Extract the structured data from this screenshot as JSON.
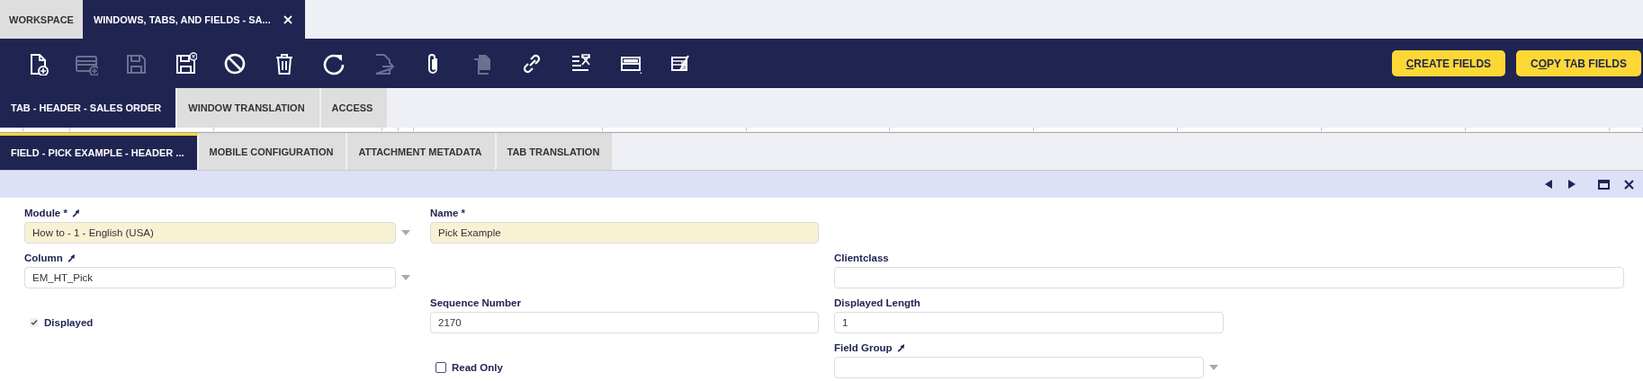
{
  "window_tabs": [
    {
      "label": "WORKSPACE",
      "selected": false,
      "closable": false
    },
    {
      "label": "WINDOWS, TABS, AND FIELDS - SA...",
      "selected": true,
      "closable": true
    }
  ],
  "toolbar": {
    "buttons": [
      {
        "disabled": false
      },
      {
        "disabled": true
      },
      {
        "disabled": true
      },
      {
        "disabled": false
      },
      {
        "disabled": false
      },
      {
        "disabled": false
      },
      {
        "disabled": false
      },
      {
        "disabled": true
      },
      {
        "disabled": false
      },
      {
        "disabled": true
      },
      {
        "disabled": false
      },
      {
        "disabled": false
      },
      {
        "disabled": false
      },
      {
        "disabled": false
      }
    ],
    "actions": [
      {
        "key": "C",
        "after": "REATE FIELDS"
      },
      {
        "before": "C",
        "key": "O",
        "after": "PY TAB FIELDS"
      }
    ]
  },
  "tab_tabs": [
    {
      "label": "TAB - HEADER - SALES ORDER",
      "selected": true
    },
    {
      "label": "WINDOW TRANSLATION",
      "selected": false
    },
    {
      "label": "ACCESS",
      "selected": false
    }
  ],
  "field_tabs": [
    {
      "label": "FIELD - PICK EXAMPLE - HEADER ...",
      "selected": true
    },
    {
      "label": "MOBILE CONFIGURATION",
      "selected": false
    },
    {
      "label": "ATTACHMENT METADATA",
      "selected": false
    },
    {
      "label": "TAB TRANSLATION",
      "selected": false
    }
  ],
  "form": {
    "rows": [
      [
        {
          "kind": "select",
          "label": "Module *",
          "linked": true,
          "required": true,
          "value": "How to - 1 - English (USA)"
        },
        {
          "kind": "text",
          "label": "Name *",
          "linked": false,
          "required": true,
          "value": "Pick Example"
        },
        {
          "kind": "blank"
        }
      ],
      [
        {
          "kind": "select",
          "label": "Column",
          "linked": true,
          "required": false,
          "value": "EM_HT_Pick"
        },
        {
          "kind": "blank"
        },
        {
          "kind": "text",
          "label": "Clientclass",
          "linked": false,
          "required": false
        }
      ],
      [
        {
          "kind": "checkbox",
          "label": "Displayed",
          "checked": true
        },
        {
          "kind": "text",
          "label": "Sequence Number",
          "linked": false,
          "required": false,
          "value": "2170"
        },
        {
          "kind": "text",
          "label": "Displayed Length",
          "linked": false,
          "required": false,
          "value": "1"
        }
      ],
      [
        {
          "kind": "blank"
        },
        {
          "kind": "checkbox",
          "label": "Read Only",
          "checked": false
        },
        {
          "kind": "select",
          "label": "Field Group",
          "linked": true,
          "required": false
        }
      ]
    ]
  }
}
